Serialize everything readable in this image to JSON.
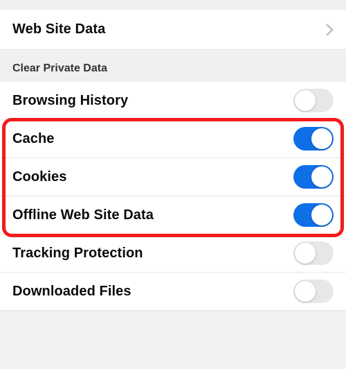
{
  "nav": {
    "web_site_data": "Web Site Data"
  },
  "section": {
    "header": "Clear Private Data"
  },
  "items": {
    "browsing_history": {
      "label": "Browsing History",
      "on": false
    },
    "cache": {
      "label": "Cache",
      "on": true
    },
    "cookies": {
      "label": "Cookies",
      "on": true
    },
    "offline": {
      "label": "Offline Web Site Data",
      "on": true
    },
    "tracking": {
      "label": "Tracking Protection",
      "on": false
    },
    "downloaded": {
      "label": "Downloaded Files",
      "on": false
    }
  },
  "colors": {
    "accent": "#0f6fe6",
    "highlight": "#f21c1c"
  }
}
